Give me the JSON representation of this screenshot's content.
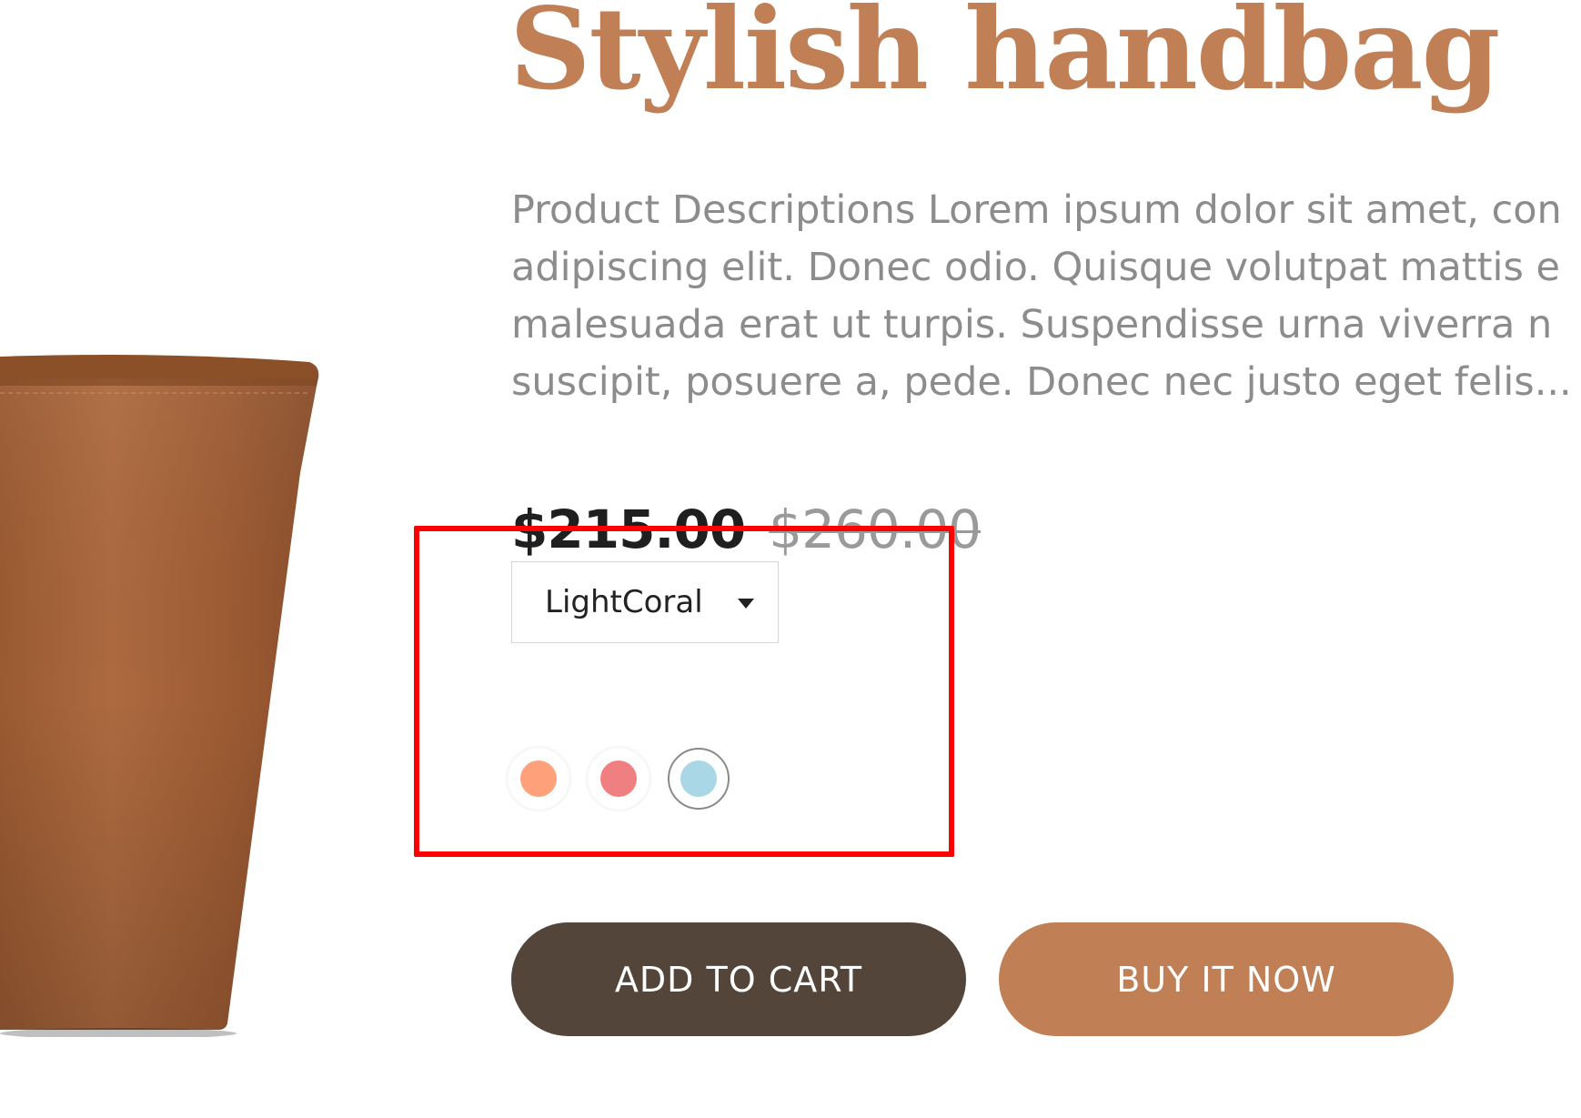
{
  "product": {
    "title": "Stylish handbag",
    "description_lines": [
      "Product Descriptions Lorem ipsum dolor sit amet, con",
      "adipiscing elit. Donec odio. Quisque volutpat mattis e",
      "malesuada erat ut turpis. Suspendisse urna viverra n",
      "suscipit, posuere a, pede. Donec nec justo eget felis..."
    ],
    "price": "$215.00",
    "compare_price": "$260.00",
    "image_icon": "handbag-image"
  },
  "variant_select": {
    "selected": "LightCoral",
    "icon": "caret-down-icon"
  },
  "swatches": [
    {
      "name": "LightSalmon",
      "color": "#fea07a",
      "selected": false
    },
    {
      "name": "LightCoral",
      "color": "#ef7f80",
      "selected": false
    },
    {
      "name": "LightBlue",
      "color": "#a9d7e5",
      "selected": true
    }
  ],
  "actions": {
    "add_to_cart": "ADD TO CART",
    "buy_now": "BUY IT NOW"
  },
  "colors": {
    "brand": "#c17f55",
    "dark_button": "#54453b",
    "highlight": "#ff0000",
    "text_muted": "#8c8c8c"
  }
}
